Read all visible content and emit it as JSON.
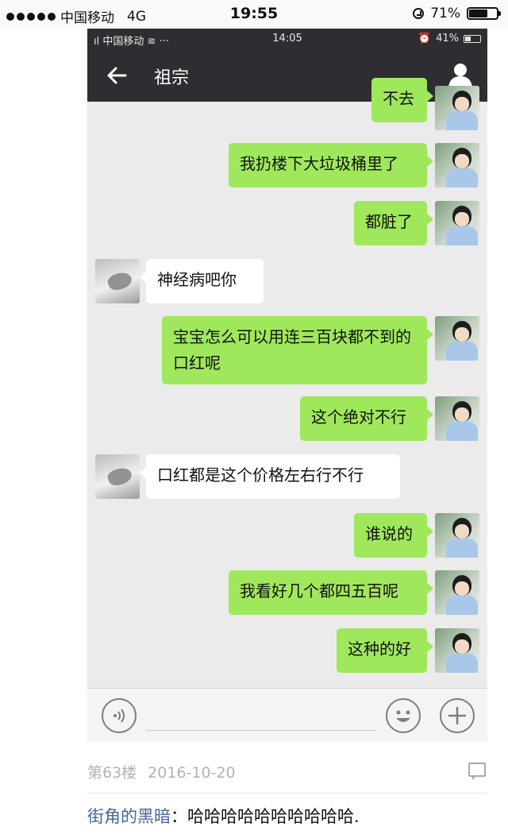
{
  "outer_status": {
    "carrier": "中国移动",
    "network": "4G",
    "time": "19:55",
    "battery_percent_label": "71%",
    "battery_level": 0.71
  },
  "inner_status": {
    "carrier": "中国移动",
    "extra": "···",
    "time": "14:05",
    "battery_percent_label": "41%",
    "battery_level": 0.41
  },
  "navbar": {
    "back_icon": "arrow-left-icon",
    "title": "祖宗",
    "profile_icon": "person-icon"
  },
  "messages": [
    {
      "sender": "me",
      "text": "不去"
    },
    {
      "sender": "me",
      "text": "我扔楼下大垃圾桶里了"
    },
    {
      "sender": "me",
      "text": "都脏了"
    },
    {
      "sender": "other",
      "text": "神经病吧你"
    },
    {
      "sender": "me",
      "text": "宝宝怎么可以用连三百块都不到的口红呢"
    },
    {
      "sender": "me",
      "text": "这个绝对不行"
    },
    {
      "sender": "other",
      "text": "口红都是这个价格左右行不行"
    },
    {
      "sender": "me",
      "text": "谁说的"
    },
    {
      "sender": "me",
      "text": "我看好几个都四五百呢"
    },
    {
      "sender": "me",
      "text": "这种的好"
    }
  ],
  "input_bar": {
    "voice_icon": "voice-icon",
    "emoji_icon": "emoji-icon",
    "plus_icon": "plus-icon"
  },
  "post": {
    "floor": "第63楼",
    "date": "2016-10-20",
    "reply_icon": "comment-icon",
    "comment_user": "街角的黑暗",
    "comment_separator": "：",
    "comment_text": "哈哈哈哈哈哈哈哈哈哈."
  },
  "colors": {
    "my_bubble": "#9fe85b",
    "their_bubble": "#ffffff",
    "nav_background": "#2e2e32",
    "chat_background": "#ebebeb",
    "username": "#45659a"
  }
}
